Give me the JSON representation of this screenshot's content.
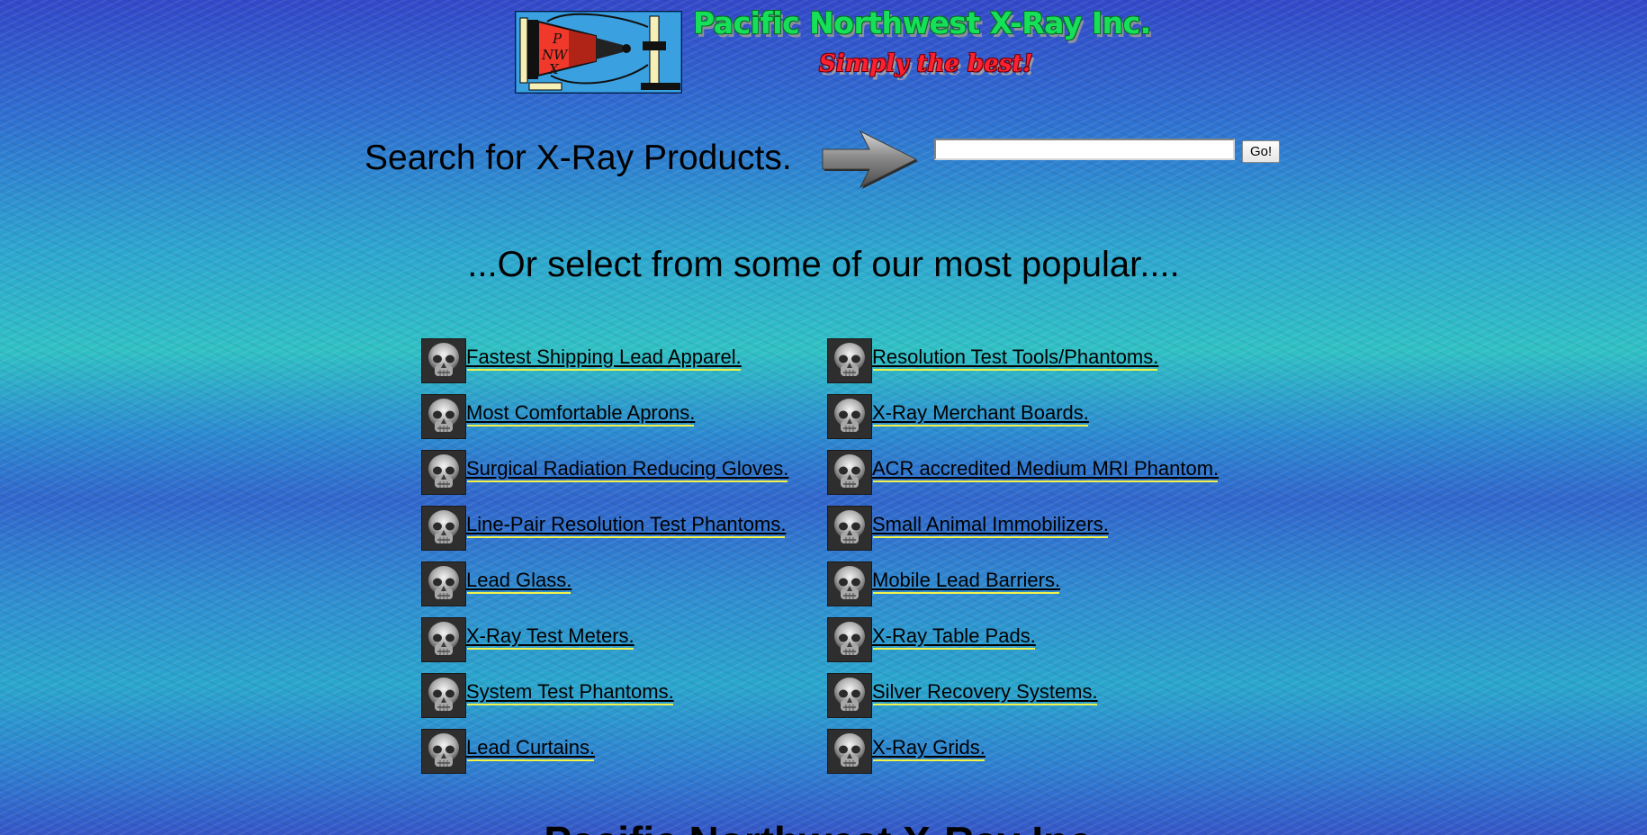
{
  "header": {
    "logo_lettering": "P NW X",
    "brand_title": "Pacific Northwest X-Ray Inc.",
    "slogan": "Simply the best!"
  },
  "search": {
    "label": "Search for X-Ray Products.",
    "input_value": "",
    "button_label": "Go!"
  },
  "popular": {
    "heading": "...Or select from some of our most popular....",
    "left_links": [
      {
        "label": "Fastest Shipping Lead Apparel.",
        "icon": "skull-xray-icon"
      },
      {
        "label": "Most Comfortable Aprons.",
        "icon": "skull-xray-icon"
      },
      {
        "label": "Surgical Radiation Reducing Gloves.",
        "icon": "skull-xray-icon"
      },
      {
        "label": "Line-Pair Resolution Test Phantoms.",
        "icon": "skull-xray-icon"
      },
      {
        "label": "Lead Glass.",
        "icon": "skull-xray-icon"
      },
      {
        "label": "X-Ray Test Meters.",
        "icon": "skull-xray-icon"
      },
      {
        "label": "System Test Phantoms.",
        "icon": "skull-xray-icon"
      },
      {
        "label": "Lead Curtains.",
        "icon": "skull-xray-icon"
      }
    ],
    "right_links": [
      {
        "label": "Resolution Test Tools/Phantoms.",
        "icon": "skull-xray-icon"
      },
      {
        "label": "X-Ray Merchant Boards.",
        "icon": "skull-xray-icon"
      },
      {
        "label": "ACR accredited Medium MRI Phantom.",
        "icon": "skull-xray-icon"
      },
      {
        "label": "Small Animal Immobilizers.",
        "icon": "skull-xray-icon"
      },
      {
        "label": "Mobile Lead Barriers.",
        "icon": "skull-xray-icon"
      },
      {
        "label": "X-Ray Table Pads.",
        "icon": "skull-xray-icon"
      },
      {
        "label": "Silver Recovery Systems.",
        "icon": "skull-xray-icon"
      },
      {
        "label": "X-Ray Grids.",
        "icon": "skull-xray-icon"
      }
    ]
  },
  "footer": {
    "title": "Pacific Northwest X-Ray Inc."
  },
  "colors": {
    "brand_green": "#16e05a",
    "slogan_red": "#ff2030",
    "link_underline_highlight": "#f2f24a"
  }
}
